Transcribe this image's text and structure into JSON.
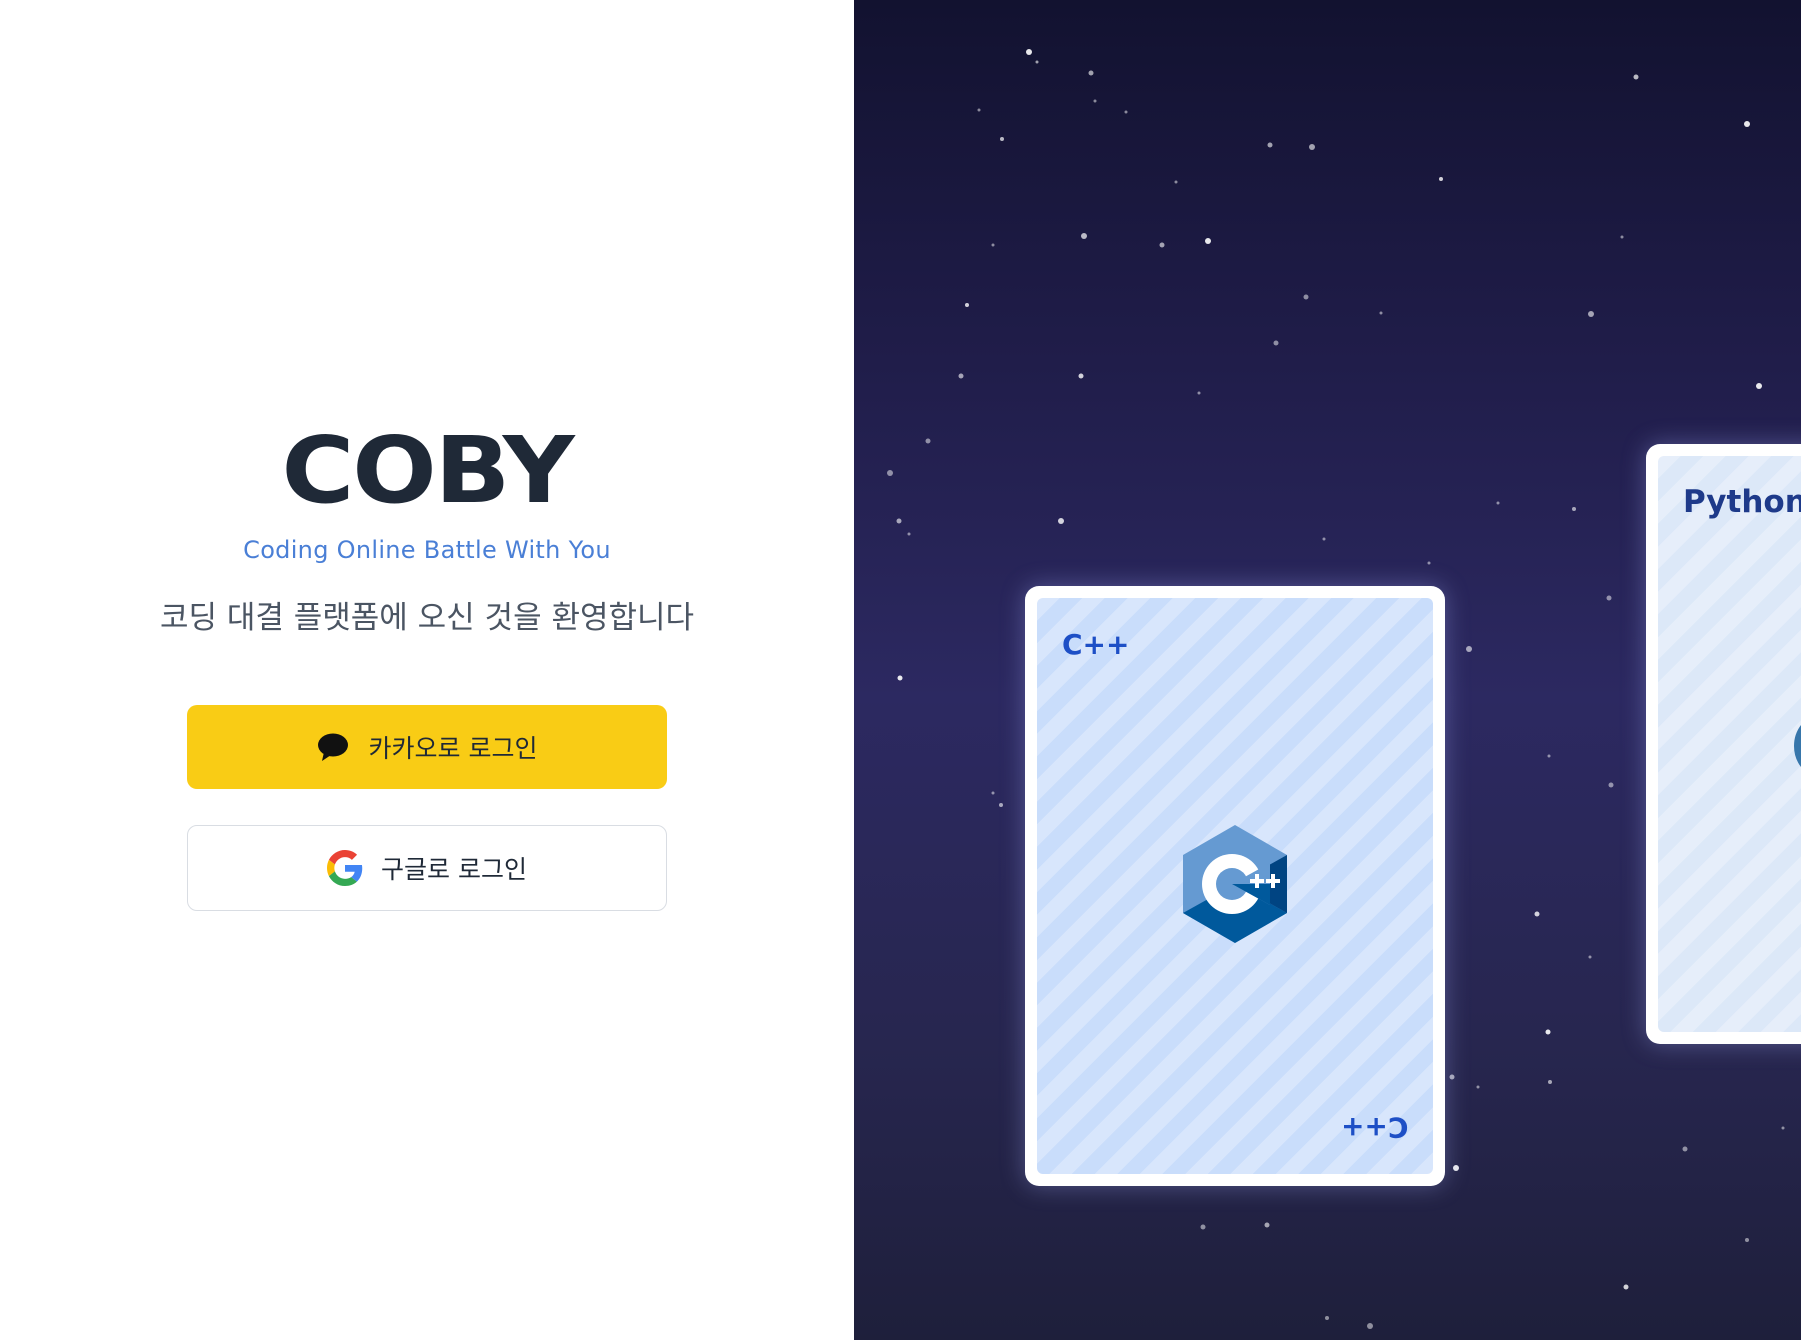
{
  "login": {
    "logo": "COBY",
    "tagline": "Coding Online Battle With You",
    "welcome": "코딩 대결 플랫폼에 오신 것을 환영합니다",
    "kakao_label": "카카오로 로그인",
    "google_label": "구글로 로그인"
  },
  "cards": {
    "cpp": {
      "title": "C++",
      "corner": "C++",
      "icon": "cpp-logo-icon"
    },
    "python": {
      "title": "Python",
      "icon": "python-logo-icon"
    }
  },
  "colors": {
    "kakao": "#f9cc15",
    "tagline": "#4a7fd6",
    "logo": "#1f2937",
    "space_bg_top": "#121230",
    "space_bg_mid": "#2c2961",
    "card_face": "#c9ddfb",
    "card_label": "#1d4fc6"
  }
}
